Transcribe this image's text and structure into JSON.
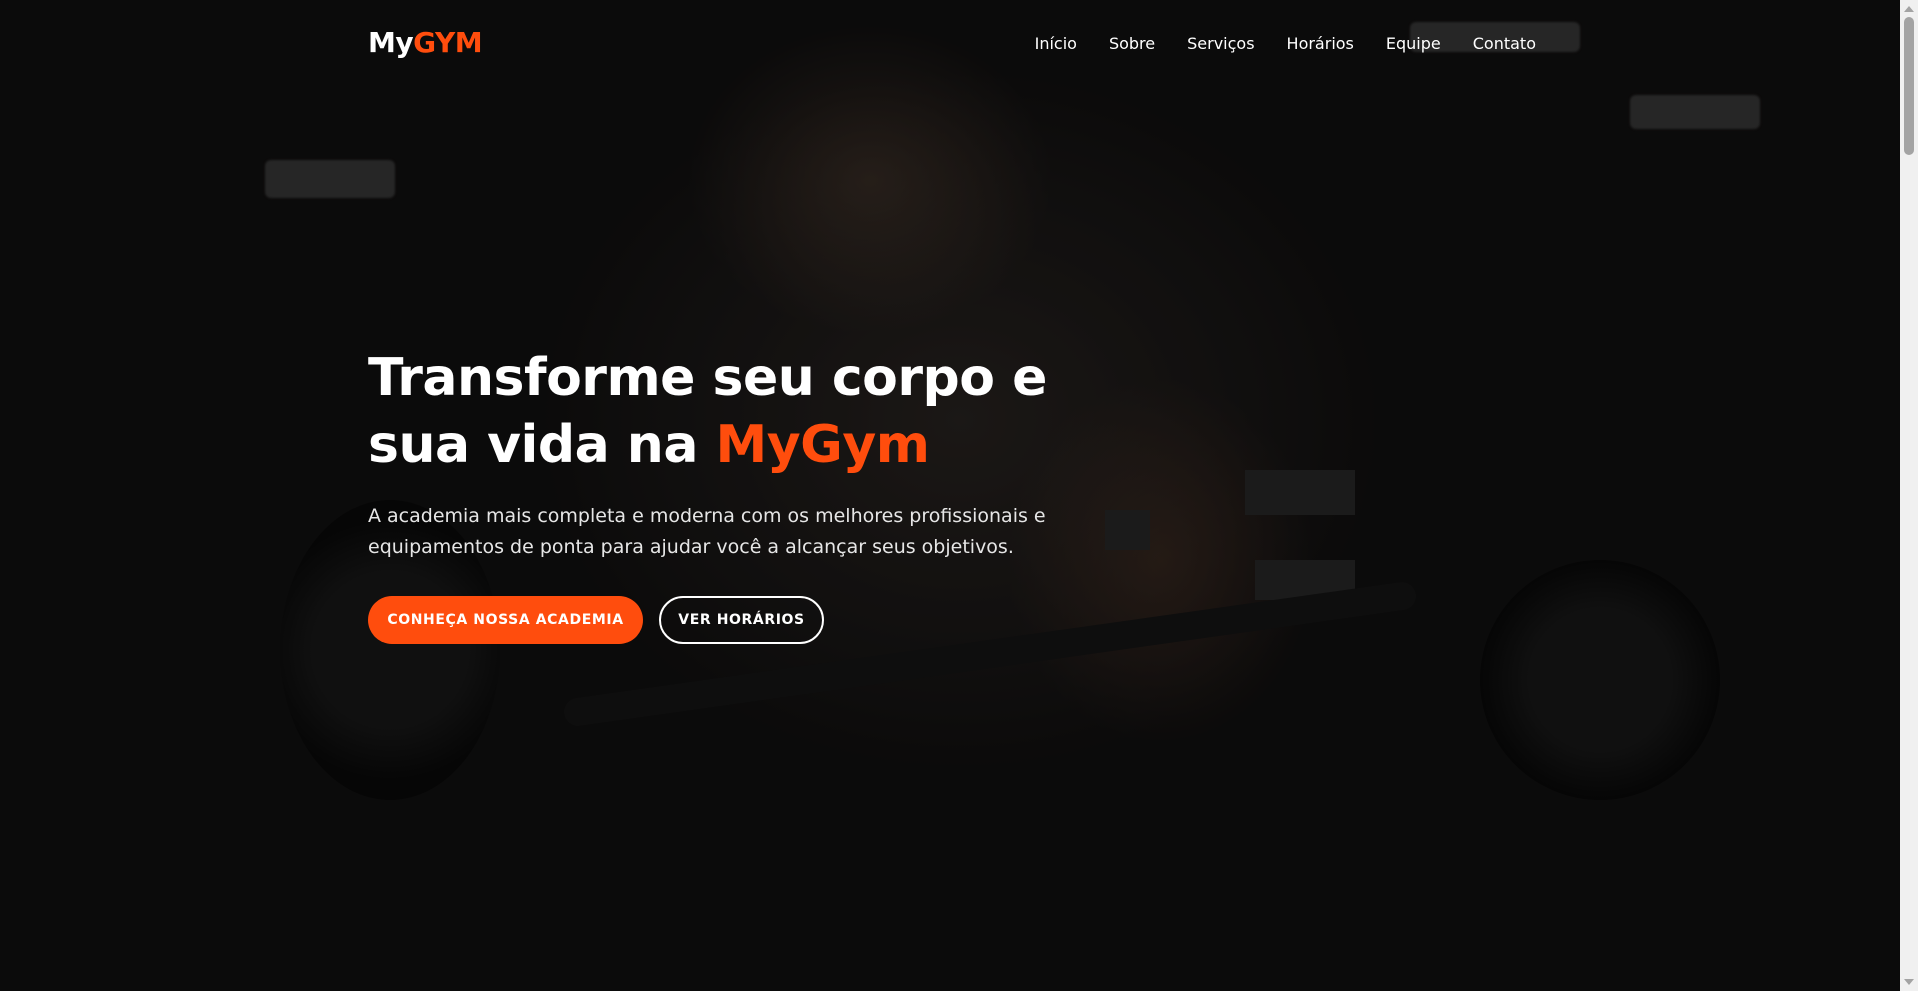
{
  "logo": {
    "text_main": "My",
    "text_accent": "GYM"
  },
  "nav": {
    "items": [
      {
        "label": "Início"
      },
      {
        "label": "Sobre"
      },
      {
        "label": "Serviços"
      },
      {
        "label": "Horários"
      },
      {
        "label": "Equipe"
      },
      {
        "label": "Contato"
      }
    ]
  },
  "hero": {
    "title_line1": "Transforme seu corpo e",
    "title_line2_prefix": "sua vida na ",
    "title_accent": "MyGym",
    "description": "A academia mais completa e moderna com os melhores profissionais e equipamentos de ponta para ajudar você a alcançar seus objetivos.",
    "primary_button": "CONHEÇA NOSSA ACADEMIA",
    "secondary_button": "VER HORÁRIOS",
    "background_image": "man-lifting-barbell-in-gym"
  },
  "colors": {
    "accent": "#ff4d0d",
    "text": "#ffffff",
    "overlay": "#000000"
  }
}
